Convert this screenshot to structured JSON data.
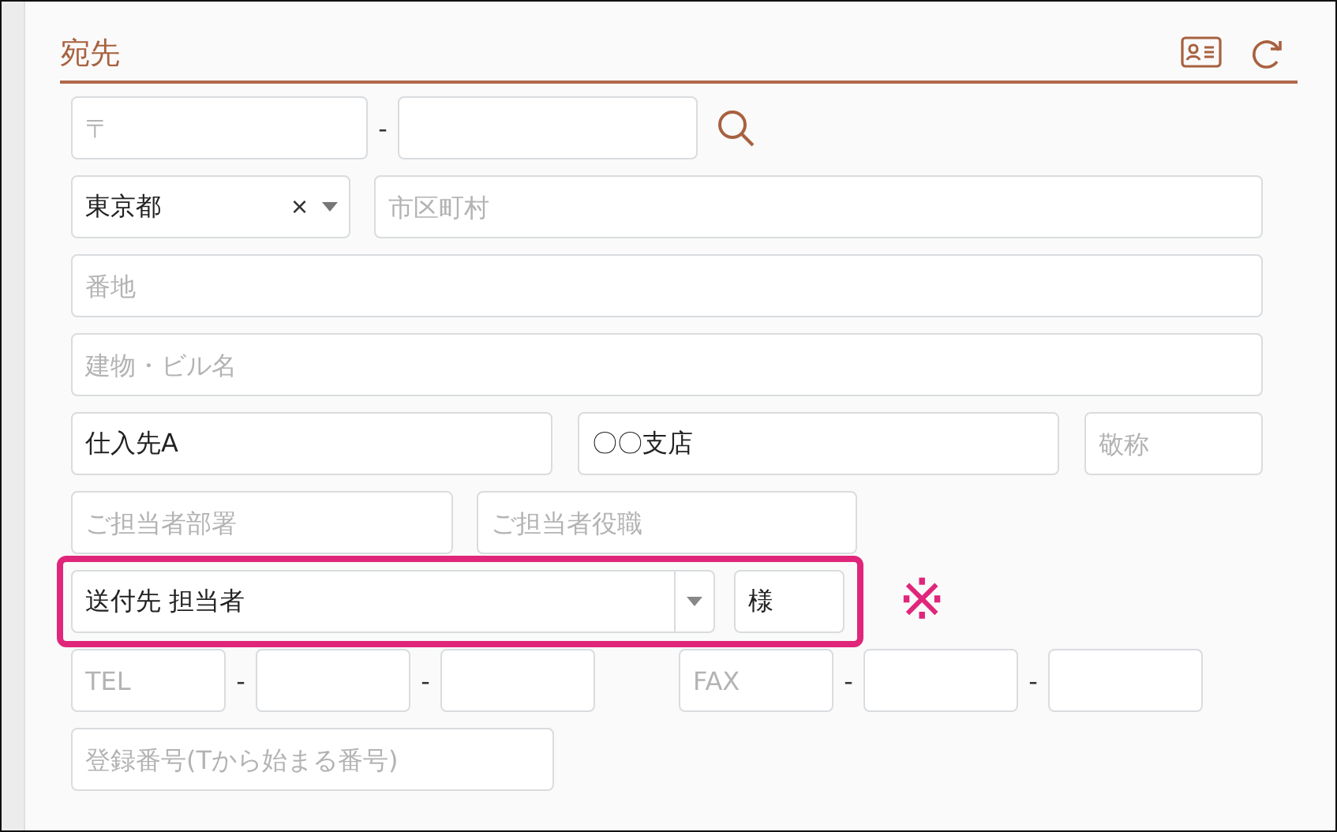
{
  "section": {
    "title": "宛先"
  },
  "postal_code": {
    "part1": {
      "placeholder": "〒"
    },
    "separator": "-"
  },
  "prefecture": {
    "value": "東京都",
    "clear": "×"
  },
  "city": {
    "placeholder": "市区町村"
  },
  "street": {
    "placeholder": "番地"
  },
  "building": {
    "placeholder": "建物・ビル名"
  },
  "company": {
    "value": "仕入先A"
  },
  "branch": {
    "value": "〇〇支店"
  },
  "company_honorific": {
    "placeholder": "敬称"
  },
  "department": {
    "placeholder": "ご担当者部署"
  },
  "position": {
    "placeholder": "ご担当者役職"
  },
  "contact": {
    "value": "送付先 担当者",
    "highlighted": true
  },
  "contact_honorific": {
    "value": "様"
  },
  "note_mark": "※",
  "tel": {
    "placeholder": "TEL",
    "separators": [
      "-",
      "-"
    ]
  },
  "fax": {
    "placeholder": "FAX",
    "separators": [
      "-",
      "-"
    ]
  },
  "registration_number": {
    "placeholder": "登録番号(Tから始まる番号)"
  }
}
